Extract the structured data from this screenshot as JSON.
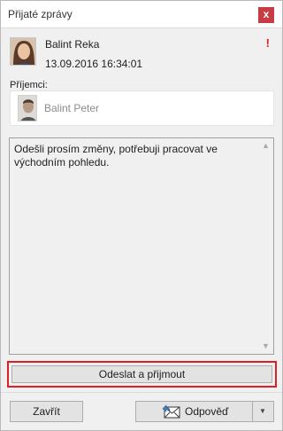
{
  "window": {
    "title": "Přijaté zprávy",
    "close_label": "x"
  },
  "sender": {
    "name": "Balint Reka",
    "datetime": "13.09.2016 16:34:01",
    "priority_marker": "!"
  },
  "recipients": {
    "label": "Příjemci:",
    "items": [
      {
        "name": "Balint Peter"
      }
    ]
  },
  "message": {
    "body": "Odešli prosím změny, potřebuji pracovat ve východním pohledu."
  },
  "actions": {
    "send_receive_label": "Odeslat a přijmout",
    "close_label": "Zavřít",
    "reply_label": "Odpověď"
  },
  "colors": {
    "accent_highlight": "#e01e25",
    "close_button": "#c73b45",
    "priority": "#e02020"
  }
}
